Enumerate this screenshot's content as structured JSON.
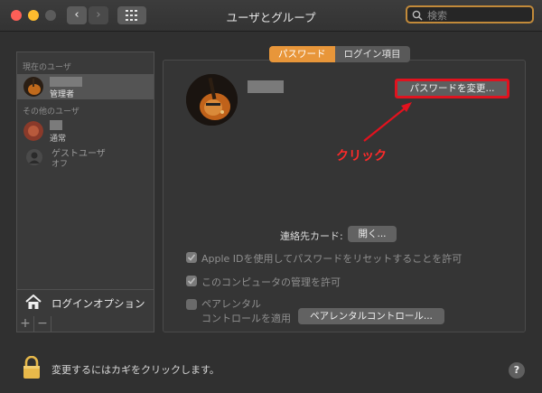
{
  "window": {
    "title": "ユーザとグループ"
  },
  "search": {
    "placeholder": "検索"
  },
  "nav": {
    "back": "‹",
    "forward": "›"
  },
  "sidebar": {
    "current_section": "現在のユーザ",
    "current_user_role": "管理者",
    "other_section": "その他のユーザ",
    "other_user_role": "通常",
    "guest_name": "ゲストユーザ",
    "guest_status": "オフ",
    "login_options": "ログインオプション",
    "add": "+",
    "remove": "−"
  },
  "tabs": [
    {
      "label": "パスワード",
      "active": true
    },
    {
      "label": "ログイン項目",
      "active": false
    }
  ],
  "main": {
    "change_password": "パスワードを変更...",
    "annotation": "クリック",
    "contact_card_label": "連絡先カード:",
    "open_button": "開く...",
    "apple_id_option": "Apple IDを使用してパスワードをリセットすることを許可",
    "admin_option": "このコンピュータの管理を許可",
    "parental_line1": "ペアレンタル",
    "parental_line2": "コントロールを適用",
    "parental_button": "ペアレンタルコントロール..."
  },
  "footer": {
    "lock_text": "変更するにはカギをクリックします。",
    "help": "?"
  },
  "colors": {
    "accent": "#e8963a",
    "highlight": "#e0131f"
  }
}
